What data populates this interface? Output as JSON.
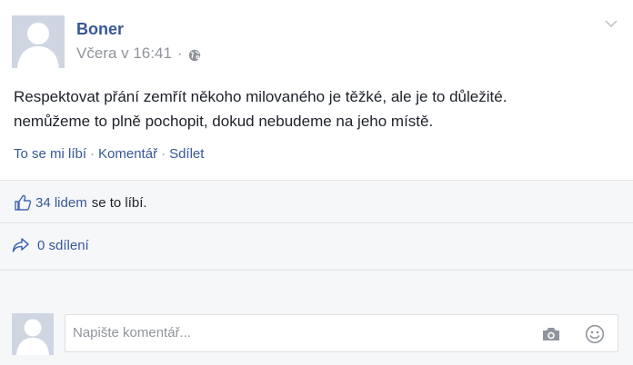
{
  "post": {
    "author": "Boner",
    "timestamp": "Včera v 16:41",
    "meta_separator": "·",
    "text_lines": [
      "Respektovat přání zemřít někoho milovaného je těžké, ale je to důležité.",
      "nemůžeme to plně pochopit, dokud nebudeme na jeho místě."
    ],
    "icons": {
      "privacy": "globe-icon",
      "options": "chevron-down-icon"
    }
  },
  "actions": {
    "like": "To se mi líbí",
    "comment": "Komentář",
    "share": "Sdílet",
    "separator": "·"
  },
  "feedback": {
    "likes_link": "34 lidem",
    "likes_suffix": "se to líbí.",
    "shares": "0 sdílení",
    "icons": {
      "like": "thumbs-up-icon",
      "share": "share-arrow-icon"
    }
  },
  "composer": {
    "placeholder": "Napište komentář...",
    "icons": {
      "photo": "camera-icon",
      "emoji": "smiley-icon"
    }
  },
  "colors": {
    "link": "#365899",
    "muted": "#90949c",
    "feedback_bg": "#f6f7f9"
  }
}
